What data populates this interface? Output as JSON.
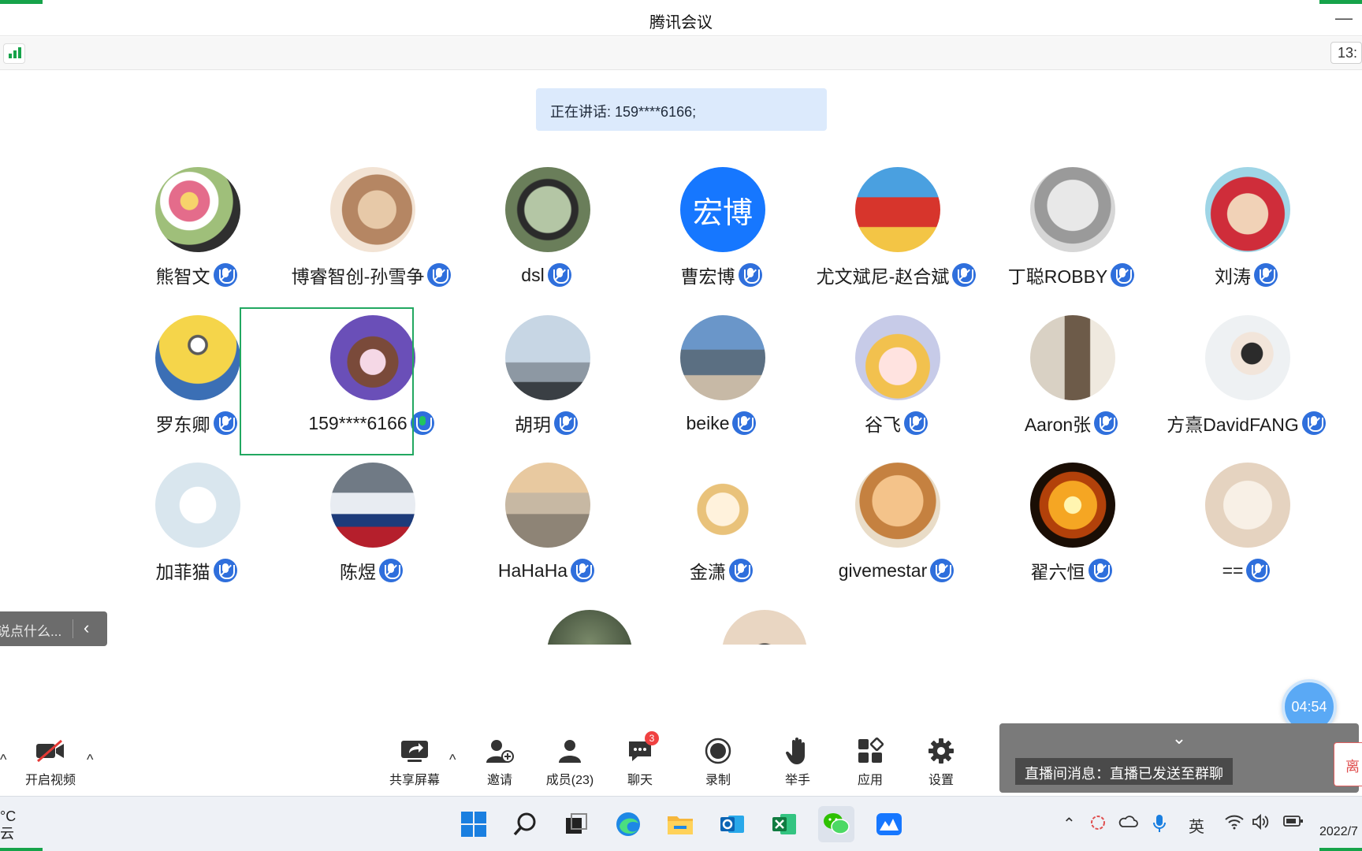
{
  "window": {
    "title": "腾讯会议"
  },
  "subbar": {
    "clock": "13:"
  },
  "speaking": {
    "text": "正在讲话: 159****6166;"
  },
  "participants": [
    {
      "name": "熊智文",
      "mic": "muted",
      "avatar": "flowers"
    },
    {
      "name": "博睿智创-孙雪争",
      "mic": "muted",
      "avatar": "anime-girl"
    },
    {
      "name": "dsl",
      "mic": "muted",
      "avatar": "mirror"
    },
    {
      "name": "曹宏博",
      "mic": "muted",
      "avatar": "initials",
      "initials": "宏博"
    },
    {
      "name": "尤文斌尼-赵合斌",
      "mic": "muted",
      "avatar": "china-cheer"
    },
    {
      "name": "丁聪ROBBY",
      "mic": "muted",
      "avatar": "cat-glasses"
    },
    {
      "name": "刘涛",
      "mic": "muted",
      "avatar": "child-hood"
    },
    {
      "name": "罗东卿",
      "mic": "muted",
      "avatar": "minion"
    },
    {
      "name": "159****6166",
      "mic": "active",
      "avatar": "bears"
    },
    {
      "name": "胡玥",
      "mic": "muted",
      "avatar": "sky-person"
    },
    {
      "name": "beike",
      "mic": "muted",
      "avatar": "seaside-girl"
    },
    {
      "name": "谷飞",
      "mic": "muted",
      "avatar": "cartoon-hat"
    },
    {
      "name": "Aaron张",
      "mic": "muted",
      "avatar": "man-room"
    },
    {
      "name": "方熹DavidFANG",
      "mic": "muted",
      "avatar": "boy-white"
    },
    {
      "name": "加菲猫",
      "mic": "muted",
      "avatar": "couple-cartoon"
    },
    {
      "name": "陈煜",
      "mic": "muted",
      "avatar": "race-car"
    },
    {
      "name": "HaHaHa",
      "mic": "muted",
      "avatar": "beach-sunset"
    },
    {
      "name": "金潇",
      "mic": "muted",
      "avatar": "girl-bow"
    },
    {
      "name": "givemestar",
      "mic": "muted",
      "avatar": "orange-cat"
    },
    {
      "name": "翟六恒",
      "mic": "muted",
      "avatar": "fire-figure"
    },
    {
      "name": "==",
      "mic": "muted",
      "avatar": "bear-hat"
    }
  ],
  "chat_input": {
    "placeholder": "说点什么..."
  },
  "timer": {
    "text": "04:54"
  },
  "controls": {
    "video": "开启视频",
    "share": "共享屏幕",
    "invite": "邀请",
    "members": "成员(23)",
    "chat": "聊天",
    "chat_badge": "3",
    "record": "录制",
    "raise_hand": "举手",
    "apps": "应用",
    "settings": "设置"
  },
  "toast": {
    "message": "直播间消息：直播已发送至群聊"
  },
  "leave_edge": {
    "text": "离"
  },
  "taskbar": {
    "weather_temp": "°C",
    "weather_desc": "云",
    "ime": "英",
    "date": "2022/7"
  }
}
